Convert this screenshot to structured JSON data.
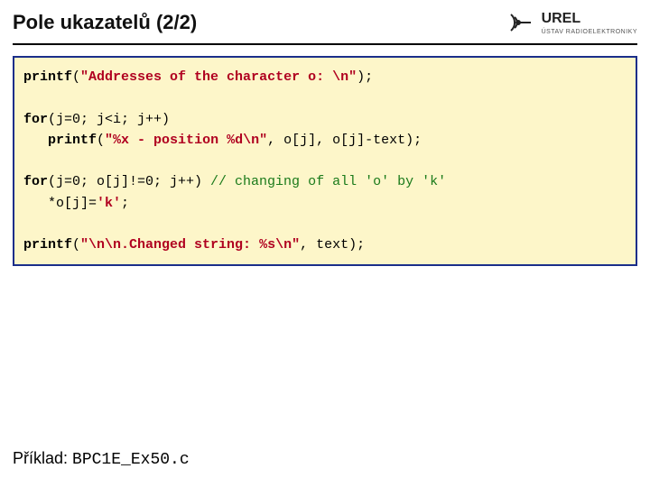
{
  "header": {
    "title": "Pole ukazatelů (2/2)",
    "logo_text": "UREL",
    "logo_sub": "ÚSTAV RADIOELEKTRONIKY"
  },
  "code": {
    "l1_kw": "printf",
    "l1_p1": "(",
    "l1_str": "\"Addresses of the character o: \\n\"",
    "l1_p2": ");",
    "l2_kw": "for",
    "l2_rest": "(j=0; j<i; j++)",
    "l3_kw": "printf",
    "l3_p1": "(",
    "l3_str": "\"%x - position %d\\n\"",
    "l3_rest": ", o[j], o[j]-text);",
    "l4_kw": "for",
    "l4_rest": "(j=0; o[j]!=0; j++) ",
    "l4_cmt": "// changing of all 'o' by 'k'",
    "l5": "   *o[j]=",
    "l5_str": "'k'",
    "l5_end": ";",
    "l6_kw": "printf",
    "l6_p1": "(",
    "l6_str": "\"\\n\\n.Changed string: %s\\n\"",
    "l6_rest": ", text);"
  },
  "footer": {
    "label": "Příklad: ",
    "file": "BPC1E_Ex50.c"
  }
}
